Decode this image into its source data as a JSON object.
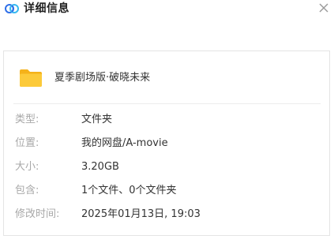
{
  "window": {
    "title": "详细信息",
    "logo_icon": "baidu-netdisk-cloud-icon",
    "close_icon": "close-icon"
  },
  "file": {
    "icon": "folder-icon",
    "icon_color": "#f9c22e",
    "name": "夏季剧场版·破晓未来"
  },
  "details": [
    {
      "label": "类型:",
      "value": "文件夹"
    },
    {
      "label": "位置:",
      "value": "我的网盘/A-movie"
    },
    {
      "label": "大小:",
      "value": "3.20GB"
    },
    {
      "label": "包含:",
      "value": "1个文件、0个文件夹"
    },
    {
      "label": "修改时间:",
      "value": "2025年01月13日, 19:03"
    }
  ]
}
